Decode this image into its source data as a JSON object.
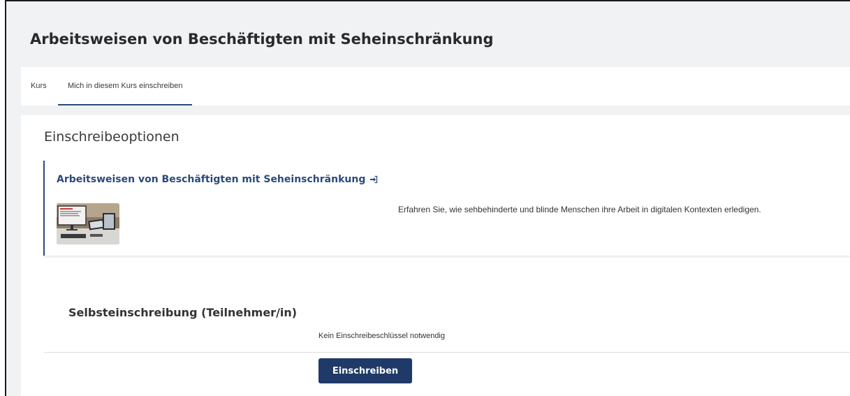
{
  "page": {
    "title": "Arbeitsweisen von Beschäftigten mit Seheinschränkung"
  },
  "tabs": [
    {
      "label": "Kurs"
    },
    {
      "label": "Mich in diesem Kurs einschreiben"
    }
  ],
  "main": {
    "heading": "Einschreibeoptionen",
    "course": {
      "title": "Arbeitsweisen von Beschäftigten mit Seheinschränkung",
      "summary": "Erfahren Sie, wie sehbehinderte und blinde Menschen ihre Arbeit in digitalen Kontexten erledigen.",
      "icon": "enrol-self-icon"
    },
    "self_enrolment": {
      "title": "Selbsteinschreibung (Teilnehmer/in)",
      "key_note": "Kein Einschreibeschlüssel notwendig",
      "button_label": "Einschreiben"
    }
  },
  "colors": {
    "accent": "#2c4a7a",
    "button": "#1f3a68",
    "header_bg": "#f1f2f4"
  }
}
